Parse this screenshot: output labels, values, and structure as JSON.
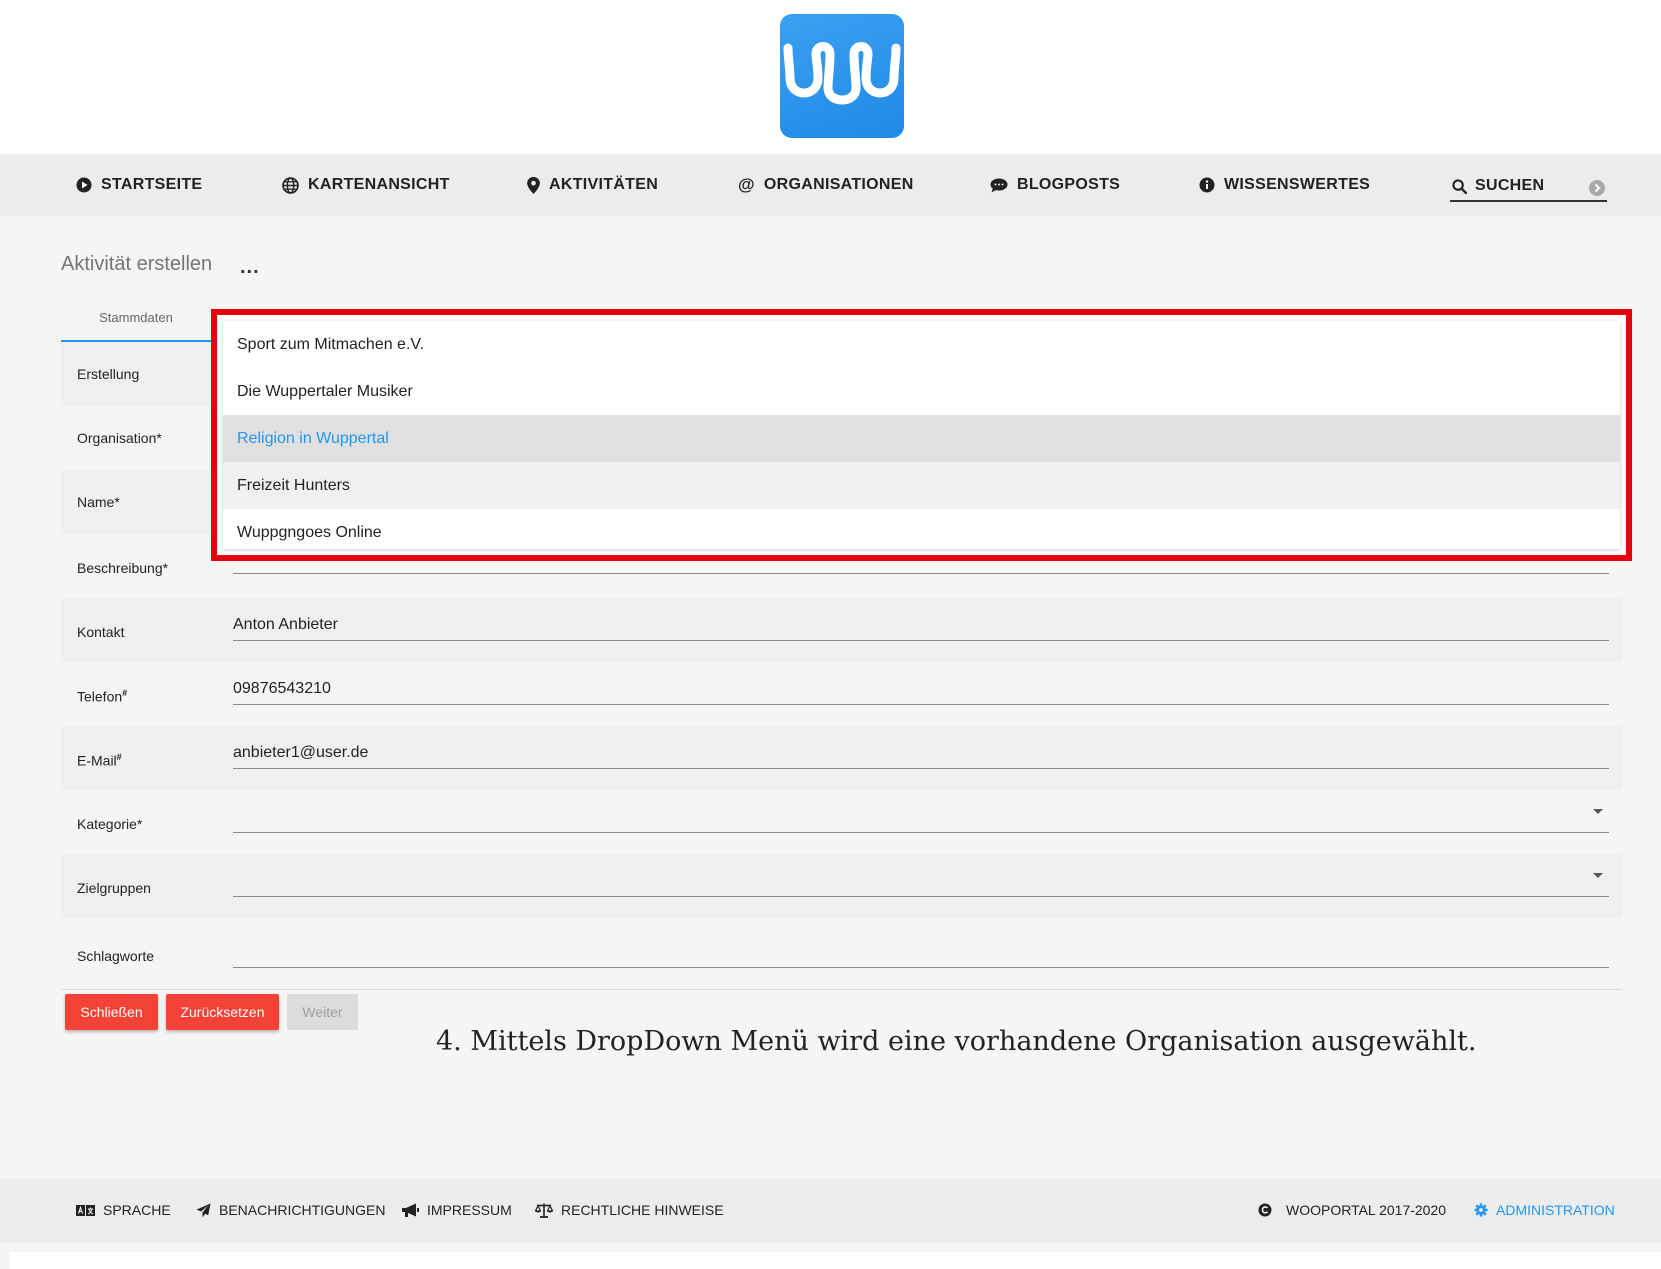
{
  "colors": {
    "accent": "#2196f3",
    "danger": "#f44336",
    "highlight_border": "#e8000c",
    "logo": "#2090e8"
  },
  "nav": {
    "items": [
      {
        "label": "STARTSEITE",
        "icon": "play-circle-icon"
      },
      {
        "label": "KARTENANSICHT",
        "icon": "globe-icon"
      },
      {
        "label": "AKTIVITÄTEN",
        "icon": "map-marker-icon"
      },
      {
        "label": "ORGANISATIONEN",
        "icon": "at-icon"
      },
      {
        "label": "BLOGPOSTS",
        "icon": "comment-icon"
      },
      {
        "label": "WISSENSWERTES",
        "icon": "info-circle-icon"
      }
    ],
    "search_label": "SUCHEN"
  },
  "page": {
    "title": "Aktivität erstellen",
    "more": "..."
  },
  "tabs": [
    {
      "label": "Stammdaten",
      "active": true
    }
  ],
  "form": {
    "rows": [
      {
        "label": "Erstellung",
        "value": ""
      },
      {
        "label": "Organisation*",
        "value": ""
      },
      {
        "label": "Name*",
        "value": ""
      },
      {
        "label": "Beschreibung*",
        "value": ""
      },
      {
        "label": "Kontakt",
        "value": "Anton Anbieter"
      },
      {
        "label": "Telefon",
        "sup": "#",
        "value": "09876543210"
      },
      {
        "label": "E-Mail",
        "sup": "#",
        "value": "anbieter1@user.de"
      },
      {
        "label": "Kategorie*",
        "value": ""
      },
      {
        "label": "Zielgruppen",
        "value": ""
      },
      {
        "label": "Schlagworte",
        "value": ""
      }
    ]
  },
  "dropdown": {
    "options": [
      "Sport zum Mitmachen e.V.",
      "Die Wuppertaler Musiker",
      "Religion in Wuppertal",
      "Freizeit Hunters",
      "Wuppgngoes Online"
    ],
    "selected": "Religion in Wuppertal"
  },
  "buttons": {
    "close": "Schließen",
    "reset": "Zurücksetzen",
    "next": "Weiter"
  },
  "caption": "4. Mittels DropDown Menü wird eine vorhandene Organisation ausgewählt.",
  "footer": {
    "language": "SPRACHE",
    "notifications": "BENACHRICHTIGUNGEN",
    "imprint": "IMPRESSUM",
    "legal": "RECHTLICHE HINWEISE",
    "copyright": "WOOPORTAL 2017-2020",
    "admin": "ADMINISTRATION"
  }
}
